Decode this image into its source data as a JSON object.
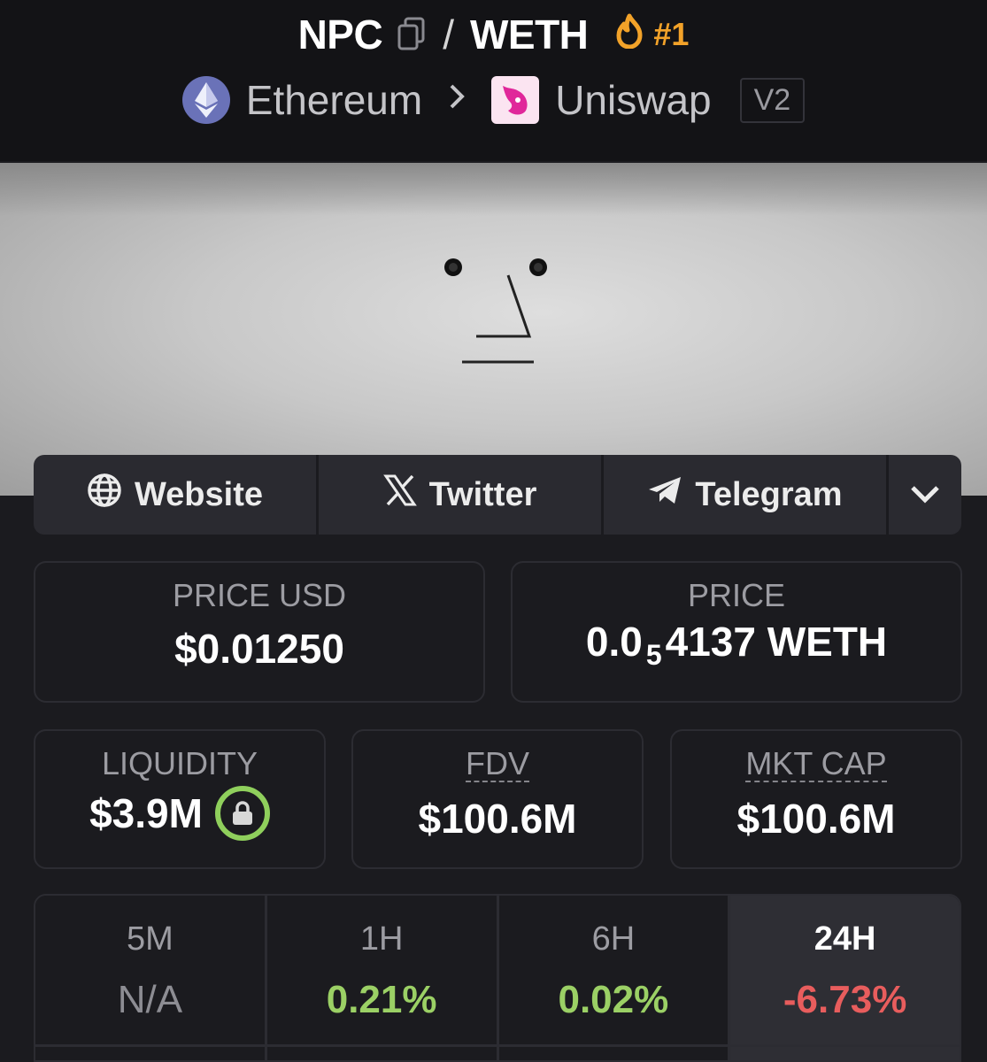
{
  "header": {
    "base_token": "NPC",
    "separator": "/",
    "quote_token": "WETH",
    "rank": "#1",
    "chain": "Ethereum",
    "dex": "Uniswap",
    "version": "V2"
  },
  "social": {
    "website": "Website",
    "twitter": "Twitter",
    "telegram": "Telegram"
  },
  "stats": {
    "price_usd_label": "PRICE USD",
    "price_usd_value": "$0.01250",
    "price_label": "PRICE",
    "price_prefix": "0.0",
    "price_zeros": "5",
    "price_suffix": "4137 WETH",
    "liquidity_label": "LIQUIDITY",
    "liquidity_value": "$3.9M",
    "fdv_label": "FDV",
    "fdv_value": "$100.6M",
    "mktcap_label": "MKT CAP",
    "mktcap_value": "$100.6M"
  },
  "timeframes": [
    {
      "label": "5M",
      "value": "N/A",
      "color": "#8d8d93"
    },
    {
      "label": "1H",
      "value": "0.21%",
      "color": "#9bd065"
    },
    {
      "label": "6H",
      "value": "0.02%",
      "color": "#9bd065"
    },
    {
      "label": "24H",
      "value": "-6.73%",
      "color": "#e85d5d"
    }
  ],
  "colors": {
    "accent": "#f2a229",
    "positive": "#9bd065",
    "negative": "#e85d5d",
    "lock": "#8fcf5c"
  }
}
